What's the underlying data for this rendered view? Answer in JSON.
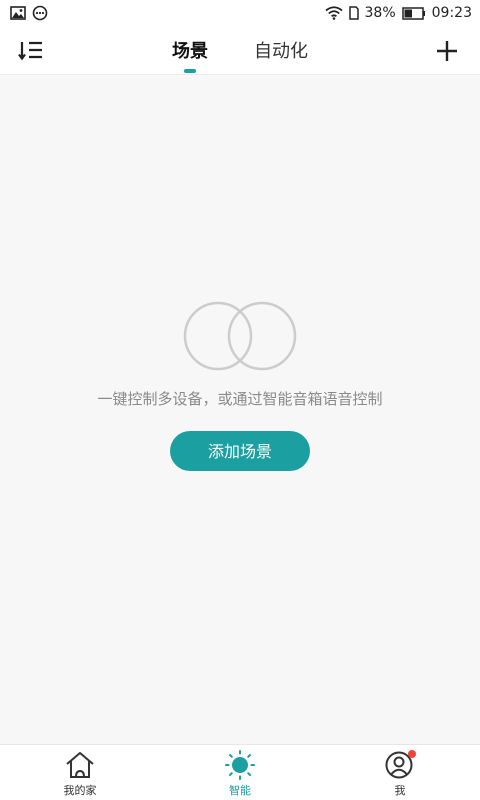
{
  "status_bar": {
    "left_icons": [
      "image-icon",
      "message-icon"
    ],
    "right_icons": [
      "wifi-icon",
      "sim-icon",
      "battery-icon"
    ],
    "battery_percent": "38%",
    "time": "09:23"
  },
  "header": {
    "sort_icon": "sort-list-icon",
    "tabs": [
      {
        "label": "场景",
        "active": true
      },
      {
        "label": "自动化",
        "active": false
      }
    ],
    "add_icon": "plus-icon"
  },
  "empty_state": {
    "icon": "overlapping-circles-icon",
    "description": "一键控制多设备，或通过智能音箱语音控制",
    "button_label": "添加场景"
  },
  "bottom_nav": {
    "items": [
      {
        "label": "我的家",
        "icon": "home-icon",
        "active": false
      },
      {
        "label": "智能",
        "icon": "sun-icon",
        "active": true
      },
      {
        "label": "我",
        "icon": "profile-icon",
        "active": false,
        "badge": true
      }
    ]
  },
  "colors": {
    "accent": "#1b9fa0",
    "background": "#f7f7f7",
    "badge": "#f04438",
    "muted_text": "#8a8a8a"
  }
}
